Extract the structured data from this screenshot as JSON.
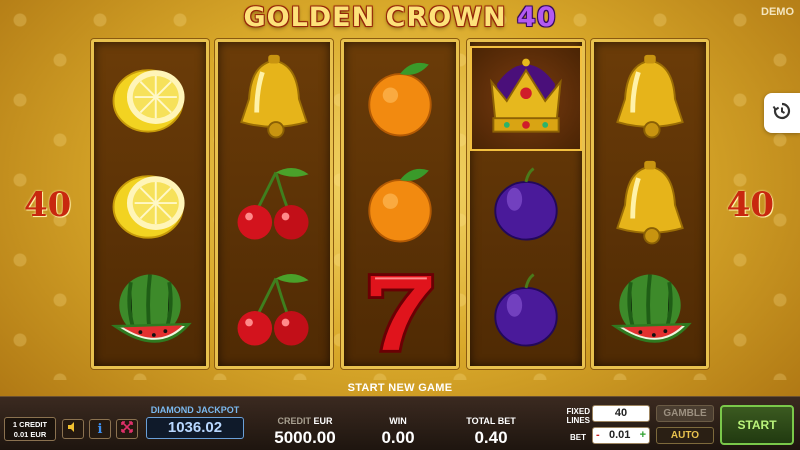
{
  "header": {
    "title_main": "GOLDEN CROWN",
    "title_num": "40",
    "demo_label": "DEMO"
  },
  "paylines": {
    "left": "40",
    "right": "40"
  },
  "reels": [
    [
      "lemon",
      "lemon",
      "watermelon"
    ],
    [
      "bell",
      "cherries",
      "cherries"
    ],
    [
      "orange",
      "orange",
      "seven"
    ],
    [
      "crown",
      "plum",
      "plum"
    ],
    [
      "bell",
      "bell",
      "watermelon"
    ]
  ],
  "message": "START NEW GAME",
  "controls": {
    "credit_ratio_line1": "1 CREDIT",
    "credit_ratio_line2": "0.01 EUR",
    "jackpot_label": "DIAMOND JACKPOT",
    "jackpot_value": "1036.02",
    "credit_label": "CREDIT",
    "credit_currency": "EUR",
    "credit_value": "5000.00",
    "win_label": "WIN",
    "win_value": "0.00",
    "total_bet_label": "TOTAL BET",
    "total_bet_value": "0.40",
    "fixed_lines_label1": "FIXED",
    "fixed_lines_label2": "LINES",
    "fixed_lines_value": "40",
    "bet_label": "BET",
    "bet_value": "0.01",
    "bet_minus": "-",
    "bet_plus": "+",
    "gamble_label": "GAMBLE",
    "auto_label": "AUTO",
    "start_label": "START"
  },
  "icons": {
    "history": "history-icon",
    "sound": "speaker-icon",
    "info": "info-icon",
    "fullscreen": "fullscreen-icon"
  },
  "colors": {
    "start_text": "#b9f37a",
    "jackpot": "#7ab9f0",
    "title_gold": "#fde27a",
    "title_purple": "#b35af2"
  }
}
